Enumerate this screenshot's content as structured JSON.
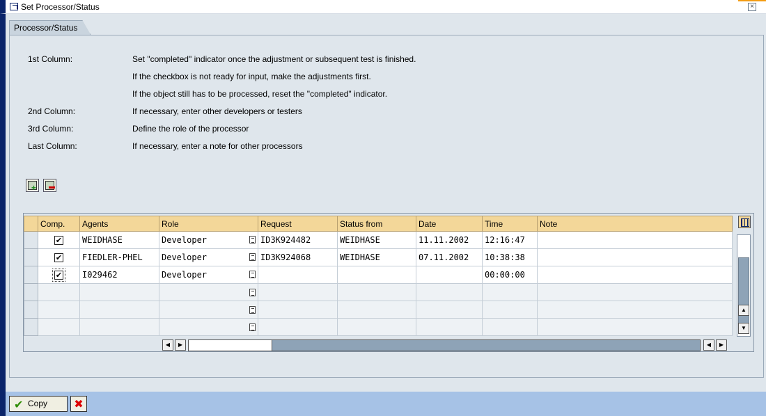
{
  "window": {
    "title": "Set Processor/Status"
  },
  "group": {
    "tab_label": "Processor/Status",
    "info": [
      {
        "label": "1st Column:",
        "text": "Set \"completed\" indicator once the adjustment or subsequent test is finished."
      },
      {
        "label": "",
        "text": "If the checkbox is not ready for input, make the adjustments first."
      },
      {
        "label": "",
        "text": "If the object still has to be processed, reset the \"completed\" indicator."
      },
      {
        "label": "2nd Column:",
        "text": "If necessary, enter other developers or testers"
      },
      {
        "label": "3rd Column:",
        "text": "Define the role of the processor"
      },
      {
        "label": "Last Column:",
        "text": "If necessary, enter a note for other processors"
      }
    ]
  },
  "table": {
    "columns": [
      "Comp.",
      "Agents",
      "Role",
      "Request",
      "Status from",
      "Date",
      "Time",
      "Note"
    ],
    "rows": [
      {
        "comp": "✔",
        "agent": "WEIDHASE",
        "role": "Developer",
        "request": "ID3K924482",
        "status_from": "WEIDHASE",
        "date": "11.11.2002",
        "time": "12:16:47",
        "note": ""
      },
      {
        "comp": "✔",
        "agent": "FIEDLER-PHEL",
        "role": "Developer",
        "request": "ID3K924068",
        "status_from": "WEIDHASE",
        "date": "07.11.2002",
        "time": "10:38:38",
        "note": ""
      },
      {
        "comp": "✔",
        "agent": "I029462",
        "role": "Developer",
        "request": "",
        "status_from": "",
        "date": "",
        "time": "00:00:00",
        "note": ""
      }
    ]
  },
  "footer": {
    "copy_label": "Copy"
  },
  "icons": {
    "append_row": "insert-row-icon",
    "delete_row": "delete-row-icon",
    "column_config": "table-settings-icon",
    "ok": "checkmark-icon",
    "cancel": "cancel-x-icon"
  }
}
